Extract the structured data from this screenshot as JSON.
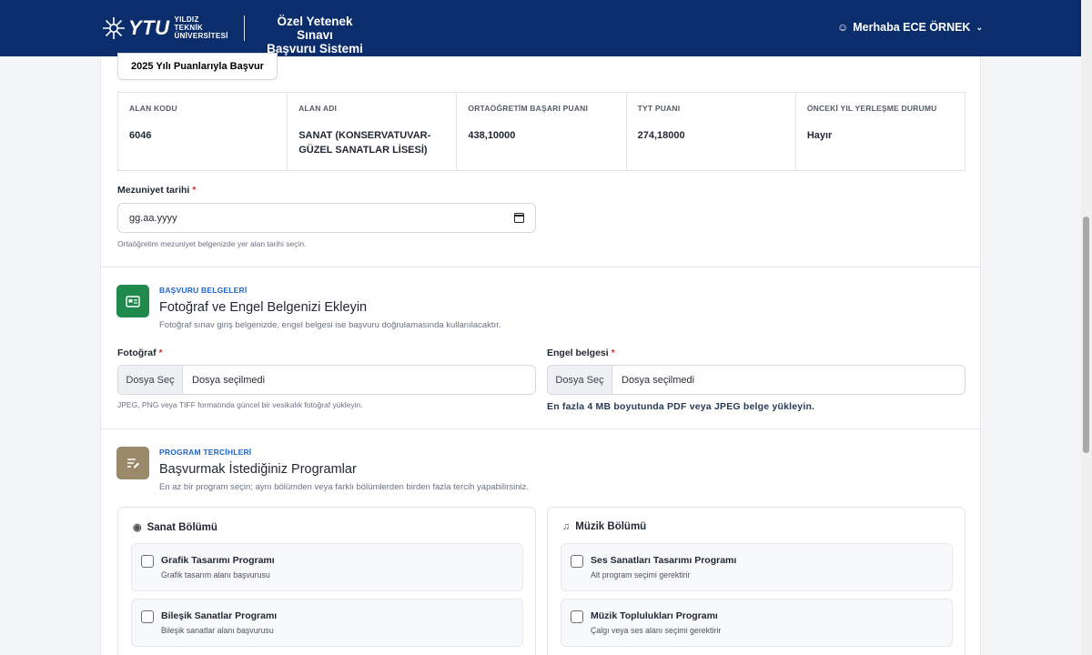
{
  "header": {
    "logo_ytu": "YTU",
    "logo_uni": "YILDIZ TEKNİK ÜNİVERSİTESİ",
    "app_title_line1": "Özel Yetenek Sınavı",
    "app_title_line2": "Başvuru Sistemi",
    "user_greeting": "Merhaba ECE ÖRNEK",
    "user_icon": "user-circle-icon",
    "chevron_icon": "chevron-down-icon"
  },
  "application": {
    "year_button": "2025 Yılı Puanlarıyla Başvur",
    "table": {
      "headers": [
        "ALAN KODU",
        "ALAN ADI",
        "ORTAÖĞRETİM BAŞARI PUANI",
        "TYT PUANI",
        "ÖNCEKİ YIL YERLEŞME DURUMU"
      ],
      "values": [
        "6046",
        "SANAT (KONSERVATUVAR-GÜZEL SANATLAR LİSESİ)",
        "438,10000",
        "274,18000",
        "Hayır"
      ]
    }
  },
  "graduation": {
    "label": "Mezuniyet tarihi",
    "required_mark": "*",
    "placeholder": "gg.aa.yyyy",
    "help": "Ortaöğretim mezuniyet belgenizde yer alan tarihi seçin."
  },
  "documents": {
    "kicker": "BAŞVURU BELGELERİ",
    "title": "Fotoğraf ve Engel Belgenizi Ekleyin",
    "subtitle": "Fotoğraf sınav giriş belgenizde, engel belgesi ise başvuru doğrulamasında kullanılacaktır.",
    "icon": "id-card-icon",
    "icon_color": "#1f8a4c",
    "photo": {
      "label": "Fotoğraf",
      "button": "Dosya Seç",
      "status": "Dosya seçilmedi",
      "help": "JPEG, PNG veya TIFF formatında güncel bir vesikalık fotoğraf yükleyin."
    },
    "disability": {
      "label": "Engel belgesi",
      "button": "Dosya Seç",
      "status": "Dosya seçilmedi",
      "help": "En fazla 4 MB boyutunda PDF veya JPEG belge yükleyin."
    }
  },
  "programs": {
    "kicker": "PROGRAM TERCİHLERİ",
    "title": "Başvurmak İstediğiniz Programlar",
    "subtitle": "En az bir program seçin; aynı bölümden veya farklı bölümlerden birden fazla tercih yapabilirsiniz.",
    "icon": "edit-list-icon",
    "icon_color": "#9a8a6a",
    "art": {
      "title": "Sanat Bölümü",
      "icon": "palette-icon",
      "options": [
        {
          "title": "Grafik Tasarımı Programı",
          "desc": "Grafik tasarım alanı başvurusu"
        },
        {
          "title": "Bileşik Sanatlar Programı",
          "desc": "Bileşik sanatlar alanı başvurusu"
        }
      ]
    },
    "music": {
      "title": "Müzik Bölümü",
      "icon": "music-note-icon",
      "options": [
        {
          "title": "Ses Sanatları Tasarımı Programı",
          "desc": "Alt program seçimi gerektirir"
        },
        {
          "title": "Müzik Toplulukları Programı",
          "desc": "Çalgı veya ses alanı seçimi gerektirir"
        }
      ]
    }
  }
}
